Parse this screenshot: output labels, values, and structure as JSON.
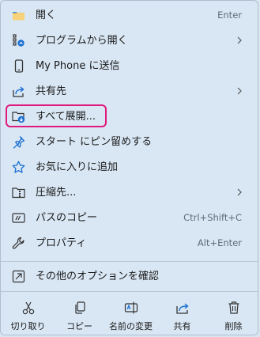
{
  "menu_items": [
    {
      "label": "開く",
      "shortcut": "Enter",
      "icon": "folder-open-icon"
    },
    {
      "label": "プログラムから開く",
      "submenu": true,
      "icon": "open-with-icon"
    },
    {
      "label": "My Phone に送信",
      "icon": "phone-icon"
    },
    {
      "label": "共有先",
      "submenu": true,
      "icon": "share-icon"
    },
    {
      "label": "すべて展開...",
      "icon": "extract-all-icon"
    },
    {
      "label": "スタート にピン留めする",
      "icon": "pin-icon"
    },
    {
      "label": "お気に入りに追加",
      "icon": "star-icon"
    },
    {
      "label": "圧縮先...",
      "submenu": true,
      "icon": "compress-icon"
    },
    {
      "label": "パスのコピー",
      "shortcut": "Ctrl+Shift+C",
      "icon": "copy-path-icon"
    },
    {
      "label": "プロパティ",
      "shortcut": "Alt+Enter",
      "icon": "wrench-icon"
    },
    {
      "label": "その他のオプションを確認",
      "icon": "more-options-icon"
    }
  ],
  "bottom_bar": [
    {
      "label": "切り取り",
      "icon": "scissors-icon"
    },
    {
      "label": "コピー",
      "icon": "copy-icon"
    },
    {
      "label": "名前の変更",
      "icon": "rename-icon"
    },
    {
      "label": "共有",
      "icon": "share-icon"
    },
    {
      "label": "削除",
      "icon": "trash-icon"
    }
  ],
  "colors": {
    "background": "#d9e7f4",
    "accent_blue": "#1c6fd1",
    "highlight_border": "#e0197d",
    "folder_yellow": "#f2c14e"
  }
}
